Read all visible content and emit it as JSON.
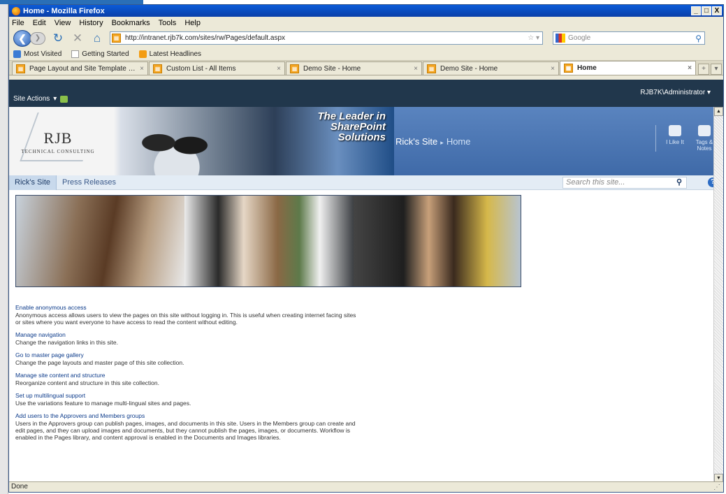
{
  "window": {
    "title": "Home - Mozilla Firefox",
    "controls": [
      "_",
      "□",
      "X"
    ]
  },
  "menu": [
    "File",
    "Edit",
    "View",
    "History",
    "Bookmarks",
    "Tools",
    "Help"
  ],
  "nav": {
    "url": "http://intranet.rjb7k.com/sites/rw/Pages/default.aspx",
    "search_placeholder": "Google"
  },
  "bookmarks": [
    {
      "label": "Most Visited",
      "color": "#3b7bd4"
    },
    {
      "label": "Getting Started",
      "color": "#ffffff"
    },
    {
      "label": "Latest Headlines",
      "color": "#f39c12"
    }
  ],
  "tabs": [
    {
      "label": "Page Layout and Site Template Settin...",
      "close": "×"
    },
    {
      "label": "Custom List - All Items",
      "close": "×"
    },
    {
      "label": "Demo Site - Home",
      "close": "×"
    },
    {
      "label": "Demo Site - Home",
      "close": "×"
    },
    {
      "label": "Home",
      "close": "×",
      "active": true
    }
  ],
  "sharepoint": {
    "site_actions": "Site Actions",
    "user": "RJB7K\\Administrator",
    "logo": {
      "name": "RJB",
      "sub": "TECHNICAL CONSULTING"
    },
    "tagline": [
      "The Leader in",
      "SharePoint",
      "Solutions"
    ],
    "breadcrumb": {
      "site": "Rick's Site",
      "page": "Home"
    },
    "social": [
      {
        "label": "I Like It"
      },
      {
        "label": "Tags & Notes"
      }
    ],
    "topnav": [
      {
        "label": "Rick's Site",
        "selected": true
      },
      {
        "label": "Press Releases"
      }
    ],
    "search_placeholder": "Search this site...",
    "help": "?"
  },
  "links": [
    {
      "title": "Enable anonymous access",
      "desc": "Anonymous access allows users to view the pages on this site without logging in. This is useful when creating internet facing sites or sites where you want everyone to have access to read the content without editing."
    },
    {
      "title": "Manage navigation",
      "desc": "Change the navigation links in this site."
    },
    {
      "title": "Go to master page gallery",
      "desc": "Change the page layouts and master page of this site collection."
    },
    {
      "title": "Manage site content and structure",
      "desc": "Reorganize content and structure in this site collection."
    },
    {
      "title": "Set up multilingual support",
      "desc": "Use the variations feature to manage multi-lingual sites and pages."
    },
    {
      "title": "Add users to the Approvers and Members groups",
      "desc": "Users in the Approvers group can publish pages, images, and documents in this site. Users in the Members group can create and edit pages, and they can upload images and documents, but they cannot publish the pages, images, or documents. Workflow is enabled in the Pages library, and content approval is enabled in the Documents and Images libraries."
    }
  ],
  "status": "Done"
}
